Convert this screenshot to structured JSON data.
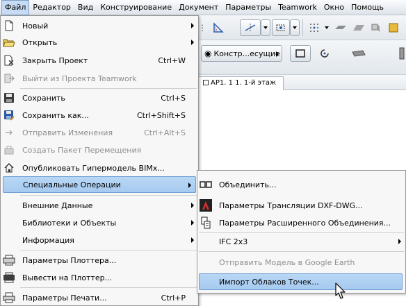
{
  "menubar": {
    "items": [
      "Файл",
      "Редактор",
      "Вид",
      "Конструирование",
      "Документ",
      "Параметры",
      "Teamwork",
      "Окно",
      "Помощь"
    ]
  },
  "toolbar": {
    "layer_combo": "Констр...есущие"
  },
  "document_tab": {
    "label": "АР1. 1 1. 1-й этаж"
  },
  "file_menu": {
    "items": [
      {
        "label": "Новый",
        "icon": "new-file-icon",
        "submenu": true
      },
      {
        "label": "Открыть",
        "icon": "open-folder-icon",
        "submenu": true
      },
      {
        "label": "Закрыть Проект",
        "shortcut": "Ctrl+W",
        "icon": "close-project-icon"
      },
      {
        "label": "Выйти из Проекта Teamwork",
        "icon": "teamwork-exit-icon",
        "disabled": true
      },
      {
        "label": "Сохранить",
        "shortcut": "Ctrl+S",
        "icon": "save-icon"
      },
      {
        "label": "Сохранить как...",
        "shortcut": "Ctrl+Shift+S",
        "icon": "save-as-icon"
      },
      {
        "label": "Отправить Изменения",
        "shortcut": "Ctrl+Alt+S",
        "icon": "send-changes-icon",
        "disabled": true
      },
      {
        "label": "Создать Пакет Перемещения",
        "icon": "package-icon",
        "disabled": true
      },
      {
        "label": "Опубликовать Гипермодель BIMx...",
        "icon": "bimx-house-icon"
      },
      {
        "label": "Специальные Операции",
        "submenu": true,
        "highlighted": true
      },
      {
        "label": "Внешние Данные",
        "submenu": true
      },
      {
        "label": "Библиотеки и Объекты",
        "submenu": true
      },
      {
        "label": "Информация",
        "submenu": true
      },
      {
        "label": "Параметры Плоттера...",
        "icon": "plotter-setup-icon"
      },
      {
        "label": "Вывести на Плоттер...",
        "icon": "plotter-icon"
      },
      {
        "label": "Параметры Печати...",
        "shortcut": "Ctrl+P",
        "icon": "printer-icon"
      }
    ]
  },
  "special_ops_menu": {
    "items": [
      {
        "label": "Объединить...",
        "icon": "merge-icon"
      },
      {
        "label": "Параметры Трансляции DXF-DWG...",
        "icon": "dxf-dwg-icon"
      },
      {
        "label": "Параметры Расширенного Объединения...",
        "icon": "advanced-merge-icon"
      },
      {
        "label": "IFC 2x3",
        "submenu": true
      },
      {
        "label": "Отправить Модель в Google Earth",
        "disabled": true
      },
      {
        "label": "Импорт Облаков Точек...",
        "highlighted": true
      }
    ]
  },
  "colors": {
    "highlight": "#a6caf0",
    "highlight_border": "#6e9ed3",
    "menu_bg": "#f7f7f7",
    "disabled_text": "#8d8d8d"
  }
}
